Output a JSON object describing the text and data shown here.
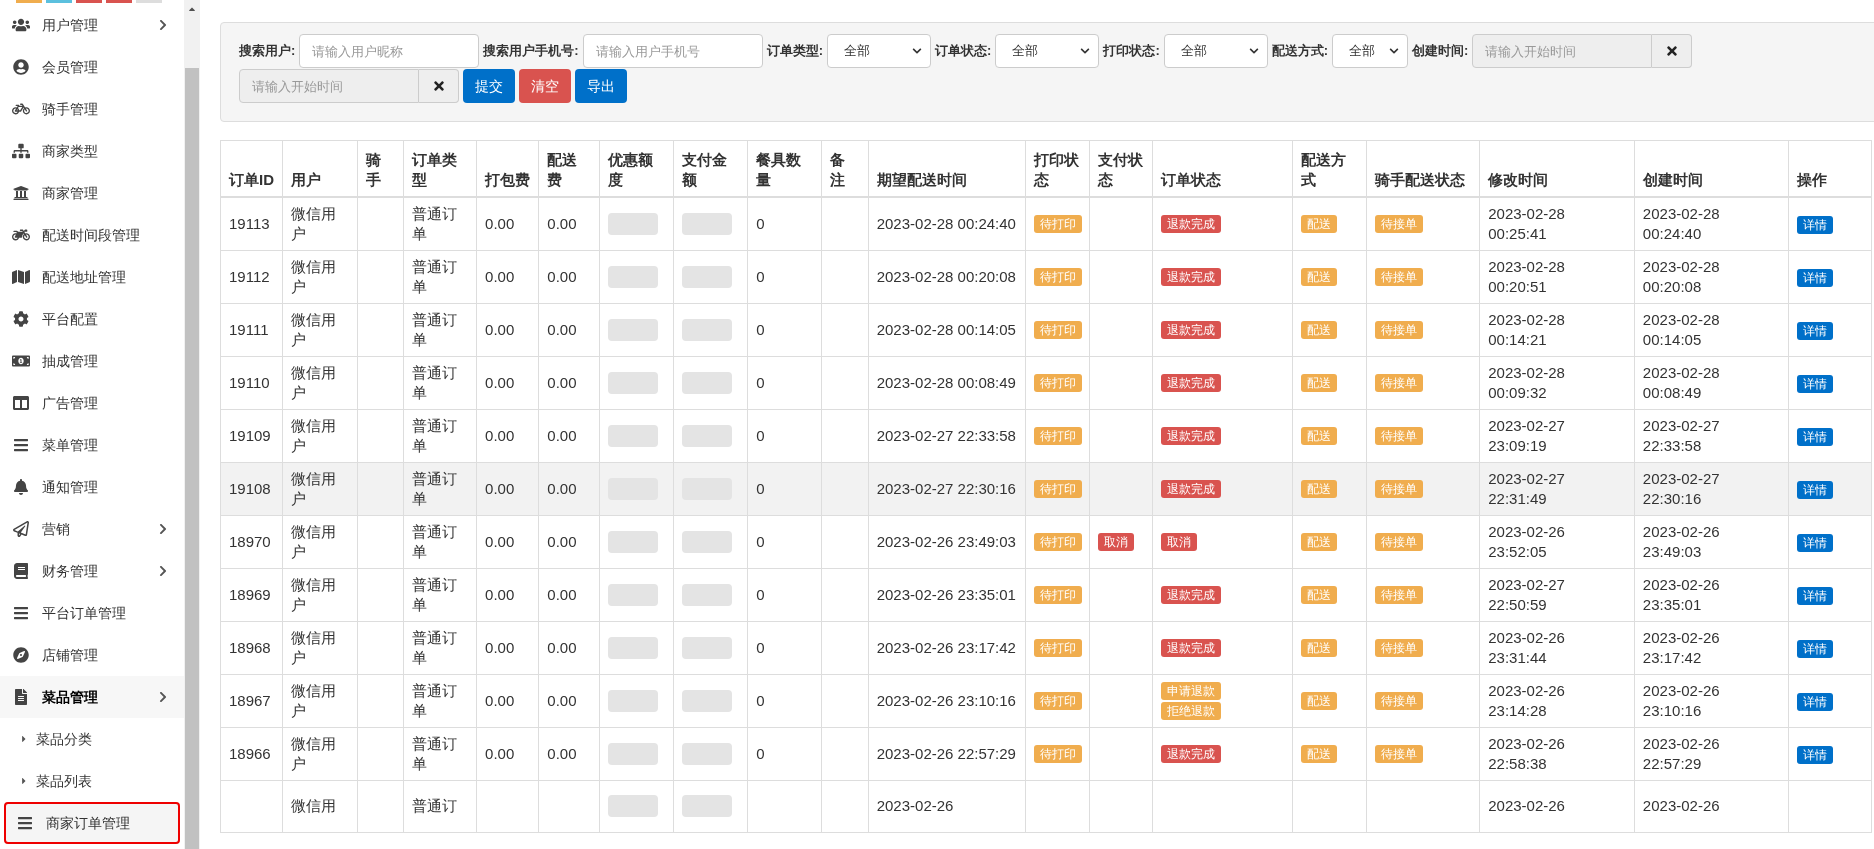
{
  "sidebar": {
    "items": [
      {
        "label": "用户管理",
        "selected": false,
        "expanded": false
      },
      {
        "label": "会员管理",
        "selected": false
      },
      {
        "label": "骑手管理",
        "selected": false
      },
      {
        "label": "商家类型",
        "selected": false
      },
      {
        "label": "商家管理",
        "selected": false
      },
      {
        "label": "配送时间段管理",
        "selected": false
      },
      {
        "label": "配送地址管理",
        "selected": false
      },
      {
        "label": "平台配置",
        "selected": false
      },
      {
        "label": "抽成管理",
        "selected": false
      },
      {
        "label": "广告管理",
        "selected": false
      },
      {
        "label": "菜单管理",
        "selected": false
      },
      {
        "label": "通知管理",
        "selected": false
      },
      {
        "label": "营销",
        "selected": false,
        "expanded": false
      },
      {
        "label": "财务管理",
        "selected": false,
        "expanded": false
      },
      {
        "label": "平台订单管理",
        "selected": false
      },
      {
        "label": "店铺管理",
        "selected": false
      },
      {
        "label": "菜品管理",
        "selected": false,
        "expanded": true,
        "children": [
          {
            "label": "菜品分类",
            "selected": false
          },
          {
            "label": "菜品列表",
            "selected": false
          }
        ]
      },
      {
        "label": "商家订单管理",
        "selected": true
      }
    ]
  },
  "filters": [
    {
      "kind": "text",
      "label": "搜索用户:",
      "placeholder": "请输入用户昵称"
    },
    {
      "kind": "text",
      "label": "搜索用户手机号:",
      "placeholder": "请输入用户手机号"
    },
    {
      "kind": "select",
      "label": "订单类型:",
      "value": "全部"
    },
    {
      "kind": "select",
      "label": "订单状态:",
      "value": "全部"
    },
    {
      "kind": "select",
      "label": "打印状态:",
      "value": "全部"
    },
    {
      "kind": "select",
      "label": "配送方式:",
      "value": "全部",
      "narrow": true
    },
    {
      "kind": "date",
      "label": "创建时间:",
      "placeholder": "请输入开始时间",
      "readonly": true
    },
    {
      "kind": "date",
      "placeholder": "请输入开始时间",
      "readonly": true
    }
  ],
  "buttons": [
    {
      "text": "提交",
      "kind": "primary"
    },
    {
      "text": "清空",
      "kind": "danger"
    },
    {
      "text": "导出",
      "kind": "primary"
    }
  ],
  "table": {
    "columns": [
      {
        "label": "订单ID"
      },
      {
        "label": "用户"
      },
      {
        "label": "骑手"
      },
      {
        "label": "订单类型"
      },
      {
        "label": "打包费"
      },
      {
        "label": "配送费"
      },
      {
        "label": "优惠额度"
      },
      {
        "label": "支付金额"
      },
      {
        "label": "餐具数量"
      },
      {
        "label": "备注"
      },
      {
        "label": "期望配送时间"
      },
      {
        "label": "打印状态"
      },
      {
        "label": "支付状态"
      },
      {
        "label": "订单状态"
      },
      {
        "label": "配送方式"
      },
      {
        "label": "骑手配送状态"
      },
      {
        "label": "修改时间"
      },
      {
        "label": "创建时间"
      },
      {
        "label": "操作"
      }
    ],
    "rows": [
      {
        "id": "19113",
        "user": "微信用户",
        "type": "普通订单",
        "pack_fee": "0.00",
        "delivery_fee": "0.00",
        "tableware": "0",
        "expected": "2023-02-28 00:24:40",
        "print": [
          {
            "text": "待打印",
            "color": "#f0ad4e"
          }
        ],
        "pay": [],
        "status": [
          {
            "text": "退款完成",
            "color": "#d9534f"
          }
        ],
        "delivery": [
          {
            "text": "配送",
            "color": "#f0ad4e"
          }
        ],
        "rider_status": [
          {
            "text": "待接单",
            "color": "#f0ad4e"
          }
        ],
        "modified": "2023-02-28 00:25:41",
        "created": "2023-02-28 00:24:40",
        "action": "详情",
        "hovered": false
      },
      {
        "id": "19112",
        "user": "微信用户",
        "type": "普通订单",
        "pack_fee": "0.00",
        "delivery_fee": "0.00",
        "tableware": "0",
        "expected": "2023-02-28 00:20:08",
        "print": [
          {
            "text": "待打印",
            "color": "#f0ad4e"
          }
        ],
        "pay": [],
        "status": [
          {
            "text": "退款完成",
            "color": "#d9534f"
          }
        ],
        "delivery": [
          {
            "text": "配送",
            "color": "#f0ad4e"
          }
        ],
        "rider_status": [
          {
            "text": "待接单",
            "color": "#f0ad4e"
          }
        ],
        "modified": "2023-02-28 00:20:51",
        "created": "2023-02-28 00:20:08",
        "action": "详情",
        "hovered": false
      },
      {
        "id": "19111",
        "user": "微信用户",
        "type": "普通订单",
        "pack_fee": "0.00",
        "delivery_fee": "0.00",
        "tableware": "0",
        "expected": "2023-02-28 00:14:05",
        "print": [
          {
            "text": "待打印",
            "color": "#f0ad4e"
          }
        ],
        "pay": [],
        "status": [
          {
            "text": "退款完成",
            "color": "#d9534f"
          }
        ],
        "delivery": [
          {
            "text": "配送",
            "color": "#f0ad4e"
          }
        ],
        "rider_status": [
          {
            "text": "待接单",
            "color": "#f0ad4e"
          }
        ],
        "modified": "2023-02-28 00:14:21",
        "created": "2023-02-28 00:14:05",
        "action": "详情",
        "hovered": false
      },
      {
        "id": "19110",
        "user": "微信用户",
        "type": "普通订单",
        "pack_fee": "0.00",
        "delivery_fee": "0.00",
        "tableware": "0",
        "expected": "2023-02-28 00:08:49",
        "print": [
          {
            "text": "待打印",
            "color": "#f0ad4e"
          }
        ],
        "pay": [],
        "status": [
          {
            "text": "退款完成",
            "color": "#d9534f"
          }
        ],
        "delivery": [
          {
            "text": "配送",
            "color": "#f0ad4e"
          }
        ],
        "rider_status": [
          {
            "text": "待接单",
            "color": "#f0ad4e"
          }
        ],
        "modified": "2023-02-28 00:09:32",
        "created": "2023-02-28 00:08:49",
        "action": "详情",
        "hovered": false
      },
      {
        "id": "19109",
        "user": "微信用户",
        "type": "普通订单",
        "pack_fee": "0.00",
        "delivery_fee": "0.00",
        "tableware": "0",
        "expected": "2023-02-27 22:33:58",
        "print": [
          {
            "text": "待打印",
            "color": "#f0ad4e"
          }
        ],
        "pay": [],
        "status": [
          {
            "text": "退款完成",
            "color": "#d9534f"
          }
        ],
        "delivery": [
          {
            "text": "配送",
            "color": "#f0ad4e"
          }
        ],
        "rider_status": [
          {
            "text": "待接单",
            "color": "#f0ad4e"
          }
        ],
        "modified": "2023-02-27 23:09:19",
        "created": "2023-02-27 22:33:58",
        "action": "详情",
        "hovered": false
      },
      {
        "id": "19108",
        "user": "微信用户",
        "type": "普通订单",
        "pack_fee": "0.00",
        "delivery_fee": "0.00",
        "tableware": "0",
        "expected": "2023-02-27 22:30:16",
        "print": [
          {
            "text": "待打印",
            "color": "#f0ad4e"
          }
        ],
        "pay": [],
        "status": [
          {
            "text": "退款完成",
            "color": "#d9534f"
          }
        ],
        "delivery": [
          {
            "text": "配送",
            "color": "#f0ad4e"
          }
        ],
        "rider_status": [
          {
            "text": "待接单",
            "color": "#f0ad4e"
          }
        ],
        "modified": "2023-02-27 22:31:49",
        "created": "2023-02-27 22:30:16",
        "action": "详情",
        "hovered": true
      },
      {
        "id": "18970",
        "user": "微信用户",
        "type": "普通订单",
        "pack_fee": "0.00",
        "delivery_fee": "0.00",
        "tableware": "0",
        "expected": "2023-02-26 23:49:03",
        "print": [
          {
            "text": "待打印",
            "color": "#f0ad4e"
          }
        ],
        "pay": [
          {
            "text": "取消",
            "color": "#d9534f"
          }
        ],
        "status": [
          {
            "text": "取消",
            "color": "#d9534f"
          }
        ],
        "delivery": [
          {
            "text": "配送",
            "color": "#f0ad4e"
          }
        ],
        "rider_status": [
          {
            "text": "待接单",
            "color": "#f0ad4e"
          }
        ],
        "modified": "2023-02-26 23:52:05",
        "created": "2023-02-26 23:49:03",
        "action": "详情",
        "hovered": false
      },
      {
        "id": "18969",
        "user": "微信用户",
        "type": "普通订单",
        "pack_fee": "0.00",
        "delivery_fee": "0.00",
        "tableware": "0",
        "expected": "2023-02-26 23:35:01",
        "print": [
          {
            "text": "待打印",
            "color": "#f0ad4e"
          }
        ],
        "pay": [],
        "status": [
          {
            "text": "退款完成",
            "color": "#d9534f"
          }
        ],
        "delivery": [
          {
            "text": "配送",
            "color": "#f0ad4e"
          }
        ],
        "rider_status": [
          {
            "text": "待接单",
            "color": "#f0ad4e"
          }
        ],
        "modified": "2023-02-27 22:50:59",
        "created": "2023-02-26 23:35:01",
        "action": "详情",
        "hovered": false
      },
      {
        "id": "18968",
        "user": "微信用户",
        "type": "普通订单",
        "pack_fee": "0.00",
        "delivery_fee": "0.00",
        "tableware": "0",
        "expected": "2023-02-26 23:17:42",
        "print": [
          {
            "text": "待打印",
            "color": "#f0ad4e"
          }
        ],
        "pay": [],
        "status": [
          {
            "text": "退款完成",
            "color": "#d9534f"
          }
        ],
        "delivery": [
          {
            "text": "配送",
            "color": "#f0ad4e"
          }
        ],
        "rider_status": [
          {
            "text": "待接单",
            "color": "#f0ad4e"
          }
        ],
        "modified": "2023-02-26 23:31:44",
        "created": "2023-02-26 23:17:42",
        "action": "详情",
        "hovered": false
      },
      {
        "id": "18967",
        "user": "微信用户",
        "type": "普通订单",
        "pack_fee": "0.00",
        "delivery_fee": "0.00",
        "tableware": "0",
        "expected": "2023-02-26 23:10:16",
        "print": [
          {
            "text": "待打印",
            "color": "#f0ad4e"
          }
        ],
        "pay": [],
        "status": [
          {
            "text": "申请退款",
            "color": "#f0ad4e"
          },
          {
            "text": "拒绝退款",
            "color": "#f0ad4e"
          }
        ],
        "delivery": [
          {
            "text": "配送",
            "color": "#f0ad4e"
          }
        ],
        "rider_status": [
          {
            "text": "待接单",
            "color": "#f0ad4e"
          }
        ],
        "modified": "2023-02-26 23:14:28",
        "created": "2023-02-26 23:10:16",
        "action": "详情",
        "hovered": false
      },
      {
        "id": "18966",
        "user": "微信用户",
        "type": "普通订单",
        "pack_fee": "0.00",
        "delivery_fee": "0.00",
        "tableware": "0",
        "expected": "2023-02-26 22:57:29",
        "print": [
          {
            "text": "待打印",
            "color": "#f0ad4e"
          }
        ],
        "pay": [],
        "status": [
          {
            "text": "退款完成",
            "color": "#d9534f"
          }
        ],
        "delivery": [
          {
            "text": "配送",
            "color": "#f0ad4e"
          }
        ],
        "rider_status": [
          {
            "text": "待接单",
            "color": "#f0ad4e"
          }
        ],
        "modified": "2023-02-26 22:58:38",
        "created": "2023-02-26 22:57:29",
        "action": "详情",
        "hovered": false
      },
      {
        "user": "微信用",
        "type": "普通订",
        "expected": "2023-02-26",
        "modified": "2023-02-26",
        "created": "2023-02-26",
        "hovered": false
      }
    ]
  }
}
